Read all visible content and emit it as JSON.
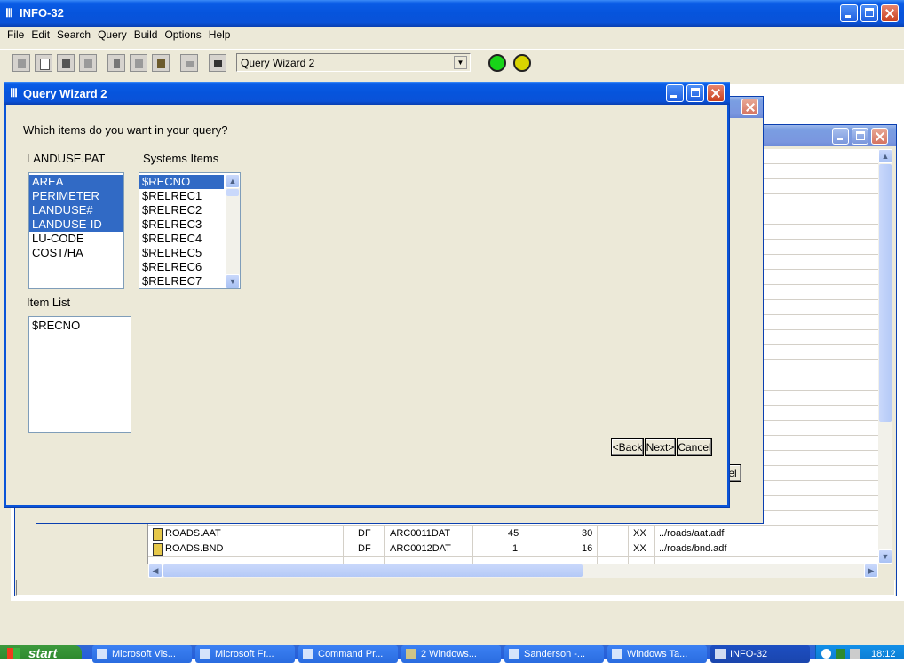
{
  "app": {
    "title": "INFO-32",
    "menu": [
      "File",
      "Edit",
      "Search",
      "Query",
      "Build",
      "Options",
      "Help"
    ],
    "toolbar_combo": "Query Wizard 2",
    "toolbar_icons": [
      "open-icon",
      "new-icon",
      "save-icon",
      "print-icon",
      "cut-icon",
      "copy-icon",
      "paste-icon",
      "undo-icon",
      "find-icon"
    ],
    "status_lights": {
      "green": "#18d418",
      "yellow": "#d8d400"
    }
  },
  "background_table": {
    "rows": [
      {
        "name": "ROADS.AAT",
        "type": "DF",
        "file": "ARC0011DAT",
        "n1": "45",
        "n2": "30",
        "flag": "XX",
        "path": "../roads/aat.adf"
      },
      {
        "name": "ROADS.BND",
        "type": "DF",
        "file": "ARC0012DAT",
        "n1": "1",
        "n2": "16",
        "flag": "XX",
        "path": "../roads/bnd.adf"
      }
    ],
    "partial_button": "el"
  },
  "dialog": {
    "title": "Query Wizard 2",
    "question": "Which items do you want in your query?",
    "landuse_label": "LANDUSE.PAT",
    "landuse_items": [
      {
        "label": "AREA",
        "selected": true
      },
      {
        "label": "PERIMETER",
        "selected": true
      },
      {
        "label": "LANDUSE#",
        "selected": true
      },
      {
        "label": "LANDUSE-ID",
        "selected": true
      },
      {
        "label": "LU-CODE",
        "selected": false
      },
      {
        "label": "COST/HA",
        "selected": false
      }
    ],
    "systems_label": "Systems Items",
    "systems_items": [
      {
        "label": "$RECNO",
        "selected": true
      },
      {
        "label": "$RELREC1",
        "selected": false
      },
      {
        "label": "$RELREC2",
        "selected": false
      },
      {
        "label": "$RELREC3",
        "selected": false
      },
      {
        "label": "$RELREC4",
        "selected": false
      },
      {
        "label": "$RELREC5",
        "selected": false
      },
      {
        "label": "$RELREC6",
        "selected": false
      },
      {
        "label": "$RELREC7",
        "selected": false
      }
    ],
    "item_list_label": "Item List",
    "item_list": [
      "$RECNO"
    ],
    "buttons": {
      "back": "<Back",
      "next": "Next>",
      "cancel": "Cancel"
    }
  },
  "taskbar": {
    "start": "start",
    "tasks": [
      "Microsoft Vis...",
      "Microsoft Fr...",
      "Command Pr...",
      "2 Windows...",
      "Sanderson -...",
      "Windows Ta...",
      "INFO-32"
    ],
    "clock": "18:12"
  }
}
